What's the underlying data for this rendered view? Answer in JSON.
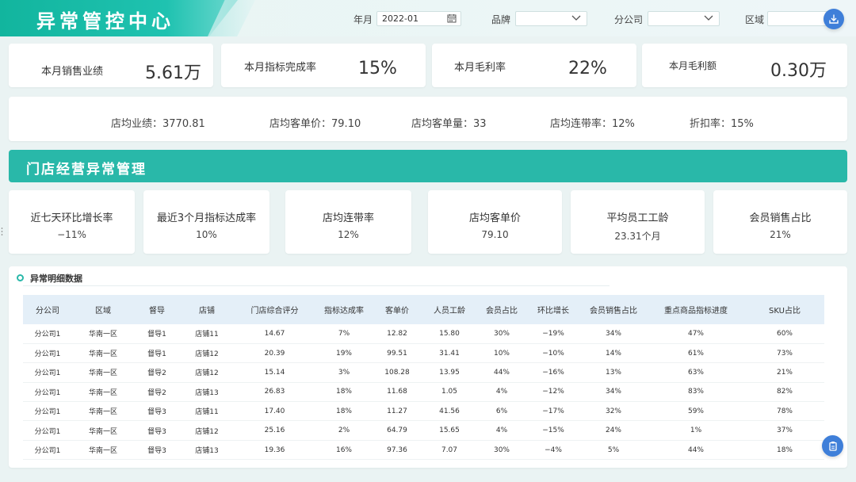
{
  "header": {
    "title": "异常管控中心",
    "filters": [
      {
        "label": "年月",
        "value": "2022-01"
      },
      {
        "label": "品牌",
        "value": ""
      },
      {
        "label": "分公司",
        "value": ""
      },
      {
        "label": "区域",
        "value": ""
      }
    ]
  },
  "kpis": [
    {
      "label": "本月销售业绩",
      "value": "5.61万"
    },
    {
      "label": "本月指标完成率",
      "value": "15%"
    },
    {
      "label": "本月毛利率",
      "value": "22%"
    },
    {
      "label": "本月毛利额",
      "value": "0.30万"
    }
  ],
  "averages": [
    {
      "label": "店均业绩：",
      "value": "3770.81"
    },
    {
      "label": "店均客单价：",
      "value": "79.10"
    },
    {
      "label": "店均客单量：",
      "value": "33"
    },
    {
      "label": "店均连带率：",
      "value": "12%"
    },
    {
      "label": "折扣率：",
      "value": "15%"
    }
  ],
  "section": {
    "title": "门店经营异常管理"
  },
  "metrics": [
    {
      "label": "近七天环比增长率",
      "value": "−11%"
    },
    {
      "label": "最近3个月指标达成率",
      "value": "10%"
    },
    {
      "label": "店均连带率",
      "value": "12%"
    },
    {
      "label": "店均客单价",
      "value": "79.10"
    },
    {
      "label": "平均员工工龄",
      "value": "23.31个月"
    },
    {
      "label": "会员销售占比",
      "value": "21%"
    }
  ],
  "detail": {
    "title": "异常明细数据",
    "columns": [
      "分公司",
      "区域",
      "督导",
      "店铺",
      "门店综合评分",
      "指标达成率",
      "客单价",
      "人员工龄",
      "会员占比",
      "环比增长",
      "会员销售占比",
      "重点商品指标进度",
      "SKU占比"
    ],
    "rows": [
      [
        "分公司1",
        "华南一区",
        "督导1",
        "店铺11",
        "14.67",
        "7%",
        "12.82",
        "15.80",
        "30%",
        "−19%",
        "34%",
        "47%",
        "60%"
      ],
      [
        "分公司1",
        "华南一区",
        "督导1",
        "店铺12",
        "20.39",
        "19%",
        "99.51",
        "31.41",
        "10%",
        "−10%",
        "14%",
        "61%",
        "73%"
      ],
      [
        "分公司1",
        "华南一区",
        "督导2",
        "店铺12",
        "15.14",
        "3%",
        "108.28",
        "13.95",
        "44%",
        "−16%",
        "13%",
        "63%",
        "21%"
      ],
      [
        "分公司1",
        "华南一区",
        "督导2",
        "店铺13",
        "26.83",
        "18%",
        "11.68",
        "1.05",
        "4%",
        "−12%",
        "34%",
        "83%",
        "82%"
      ],
      [
        "分公司1",
        "华南一区",
        "督导3",
        "店铺11",
        "17.40",
        "18%",
        "11.27",
        "41.56",
        "6%",
        "−17%",
        "32%",
        "59%",
        "78%"
      ],
      [
        "分公司1",
        "华南一区",
        "督导3",
        "店铺12",
        "25.16",
        "2%",
        "64.79",
        "15.65",
        "4%",
        "−15%",
        "24%",
        "1%",
        "37%"
      ],
      [
        "分公司1",
        "华南一区",
        "督导3",
        "店铺13",
        "19.36",
        "16%",
        "97.36",
        "7.07",
        "30%",
        "−4%",
        "5%",
        "44%",
        "18%"
      ]
    ]
  },
  "icons": {
    "download": "download-icon",
    "calendar": "calendar-icon",
    "chevron": "chevron-down-icon",
    "float": "clipboard-icon"
  },
  "colors": {
    "accent": "#29b8a9",
    "button": "#3f7fd9",
    "table_header": "#e4eff8"
  }
}
